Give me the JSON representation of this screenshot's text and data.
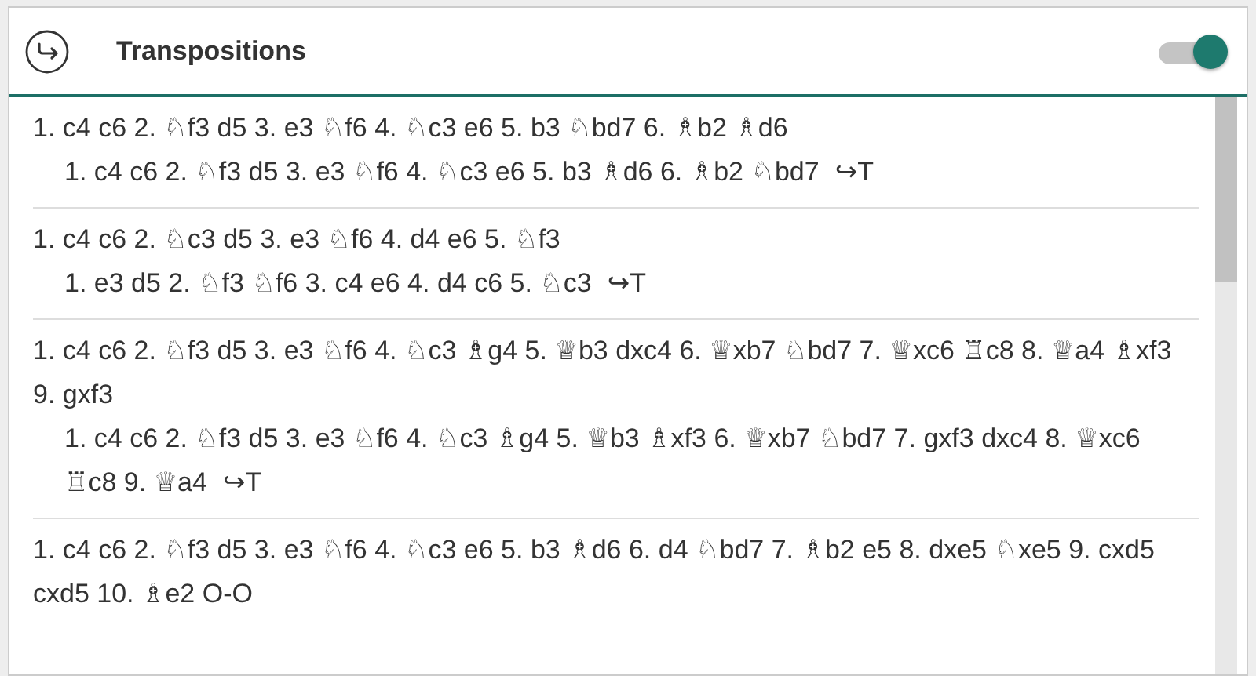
{
  "header": {
    "title": "Transpositions",
    "toggle": {
      "on": true
    }
  },
  "entries": [
    {
      "line": "1. c4 c6 2. ♘f3 d5 3. e3 ♘f6 4. ♘c3 e6 5. b3 ♘bd7 6. ♗b2 ♗d6",
      "transposition": "1. c4 c6 2. ♘f3 d5 3. e3 ♘f6 4. ♘c3 e6 5. b3 ♗d6 6. ♗b2 ♘bd7",
      "marker": "↪T"
    },
    {
      "line": "1. c4 c6 2. ♘c3 d5 3. e3 ♘f6 4. d4 e6 5. ♘f3",
      "transposition": "1. e3 d5 2. ♘f3 ♘f6 3. c4 e6 4. d4 c6 5. ♘c3",
      "marker": "↪T"
    },
    {
      "line": "1. c4 c6 2. ♘f3 d5 3. e3 ♘f6 4. ♘c3 ♗g4 5. ♕b3 dxc4 6. ♕xb7 ♘bd7 7. ♕xc6 ♖c8 8. ♕a4 ♗xf3 9. gxf3",
      "transposition": "1. c4 c6 2. ♘f3 d5 3. e3 ♘f6 4. ♘c3 ♗g4 5. ♕b3 ♗xf3 6. ♕xb7 ♘bd7 7. gxf3 dxc4 8. ♕xc6 ♖c8 9. ♕a4",
      "marker": "↪T"
    },
    {
      "line": "1. c4 c6 2. ♘f3 d5 3. e3 ♘f6 4. ♘c3 e6 5. b3 ♗d6 6. d4 ♘bd7 7. ♗b2 e5 8. dxe5 ♘xe5 9. cxd5 cxd5 10. ♗e2 O-O"
    }
  ]
}
